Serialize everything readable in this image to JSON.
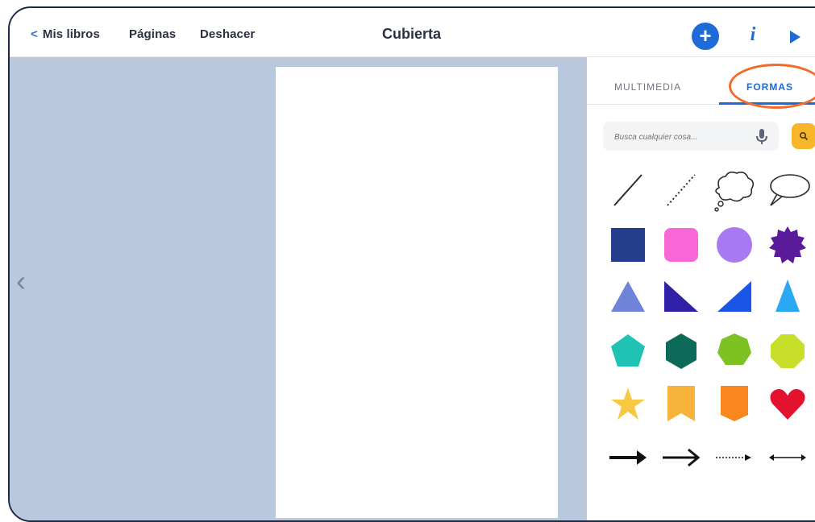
{
  "header": {
    "back_label": "Mis libros",
    "pages_label": "Páginas",
    "undo_label": "Deshacer",
    "title": "Cubierta",
    "add_icon": "plus-icon",
    "info_icon": "info-icon",
    "play_icon": "play-icon"
  },
  "panel": {
    "tabs": [
      {
        "label": "MULTIMEDIA",
        "active": false
      },
      {
        "label": "FORMAS",
        "active": true
      }
    ],
    "search": {
      "placeholder": "Busca cualquier cosa..."
    }
  },
  "shapes": [
    "line",
    "dotted-line",
    "thought-bubble",
    "speech-bubble",
    "square",
    "rounded-square",
    "circle",
    "badge",
    "triangle",
    "right-triangle-left",
    "right-triangle-right",
    "tall-triangle",
    "pentagon",
    "hexagon",
    "heptagon",
    "octagon",
    "star",
    "bookmark",
    "banner",
    "heart",
    "arrow-bold",
    "arrow-thin",
    "arrow-dotted",
    "arrow-double"
  ],
  "colors": {
    "accent": "#1e6ad8",
    "highlight": "#f26b2a",
    "canvas": "#b9c8dc",
    "navy": "#263f8c",
    "pink": "#f768d6",
    "lavender": "#a77af3",
    "purple": "#5a1b9a",
    "blue-triangle": "#6f83d8",
    "indigo": "#3020a8",
    "bright-blue": "#1a55e8",
    "sky": "#29a9f2",
    "teal": "#20c2b3",
    "dark-green": "#0d6a58",
    "green": "#7dc221",
    "lime": "#c8df2a",
    "yellow": "#f7c842",
    "orange-yellow": "#f8b33a",
    "orange": "#f8881e",
    "red": "#e3122e"
  }
}
